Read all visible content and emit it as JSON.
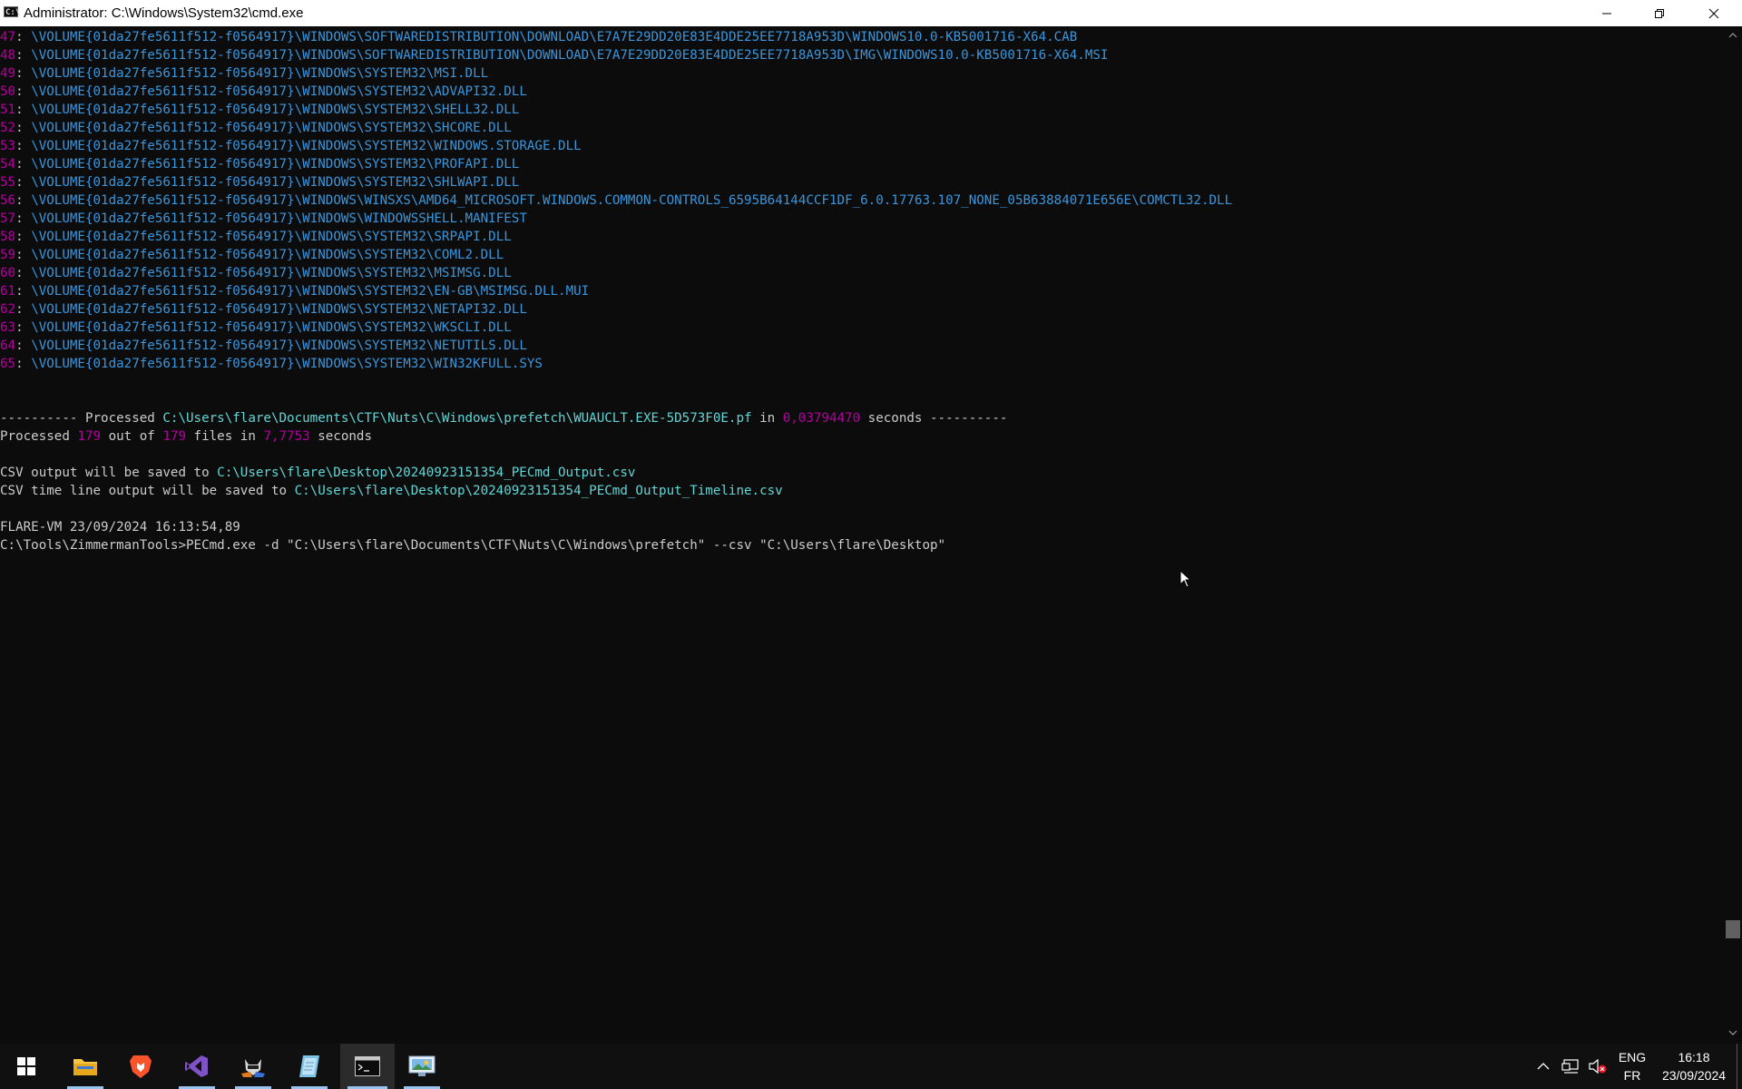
{
  "window": {
    "title": "Administrator: C:\\Windows\\System32\\cmd.exe",
    "app_icon_text": "C:\\"
  },
  "console": {
    "volume": "\\VOLUME{01da27fe5611f512-f0564917}",
    "listing": [
      {
        "num": "47",
        "path": "\\WINDOWS\\SOFTWAREDISTRIBUTION\\DOWNLOAD\\E7A7E29DD20E83E4DDE25EE7718A953D\\WINDOWS10.0-KB5001716-X64.CAB"
      },
      {
        "num": "48",
        "path": "\\WINDOWS\\SOFTWAREDISTRIBUTION\\DOWNLOAD\\E7A7E29DD20E83E4DDE25EE7718A953D\\IMG\\WINDOWS10.0-KB5001716-X64.MSI"
      },
      {
        "num": "49",
        "path": "\\WINDOWS\\SYSTEM32\\MSI.DLL"
      },
      {
        "num": "50",
        "path": "\\WINDOWS\\SYSTEM32\\ADVAPI32.DLL"
      },
      {
        "num": "51",
        "path": "\\WINDOWS\\SYSTEM32\\SHELL32.DLL"
      },
      {
        "num": "52",
        "path": "\\WINDOWS\\SYSTEM32\\SHCORE.DLL"
      },
      {
        "num": "53",
        "path": "\\WINDOWS\\SYSTEM32\\WINDOWS.STORAGE.DLL"
      },
      {
        "num": "54",
        "path": "\\WINDOWS\\SYSTEM32\\PROFAPI.DLL"
      },
      {
        "num": "55",
        "path": "\\WINDOWS\\SYSTEM32\\SHLWAPI.DLL"
      },
      {
        "num": "56",
        "path": "\\WINDOWS\\WINSXS\\AMD64_MICROSOFT.WINDOWS.COMMON-CONTROLS_6595B64144CCF1DF_6.0.17763.107_NONE_05B63884071E656E\\COMCTL32.DLL"
      },
      {
        "num": "57",
        "path": "\\WINDOWS\\WINDOWSSHELL.MANIFEST"
      },
      {
        "num": "58",
        "path": "\\WINDOWS\\SYSTEM32\\SRPAPI.DLL"
      },
      {
        "num": "59",
        "path": "\\WINDOWS\\SYSTEM32\\COML2.DLL"
      },
      {
        "num": "60",
        "path": "\\WINDOWS\\SYSTEM32\\MSIMSG.DLL"
      },
      {
        "num": "61",
        "path": "\\WINDOWS\\SYSTEM32\\EN-GB\\MSIMSG.DLL.MUI"
      },
      {
        "num": "62",
        "path": "\\WINDOWS\\SYSTEM32\\NETAPI32.DLL"
      },
      {
        "num": "63",
        "path": "\\WINDOWS\\SYSTEM32\\WKSCLI.DLL"
      },
      {
        "num": "64",
        "path": "\\WINDOWS\\SYSTEM32\\NETUTILS.DLL"
      },
      {
        "num": "65",
        "path": "\\WINDOWS\\SYSTEM32\\WIN32KFULL.SYS"
      }
    ],
    "processed_line": {
      "prefix": "---------- Processed ",
      "file": "C:\\Users\\flare\\Documents\\CTF\\Nuts\\C\\Windows\\prefetch\\WUAUCLT.EXE-5D573F0E.pf",
      "in_text": " in ",
      "seconds_value": "0,03794470",
      "suffix": " seconds ----------"
    },
    "summary_line": {
      "a": "Processed ",
      "count": "179",
      "b": " out of ",
      "total": "179",
      "c": " files in ",
      "time": "7,7753",
      "d": " seconds"
    },
    "csv_line": {
      "label": "CSV output will be saved to ",
      "path": "C:\\Users\\flare\\Desktop\\20240923151354_PECmd_Output.csv"
    },
    "timeline_line": {
      "label": "CSV time line output will be saved to ",
      "path": "C:\\Users\\flare\\Desktop\\20240923151354_PECmd_Output_Timeline.csv"
    },
    "prompt_header": "FLARE-VM 23/09/2024 16:13:54,89",
    "prompt_line": "C:\\Tools\\ZimmermanTools>PECmd.exe -d \"C:\\Users\\flare\\Documents\\CTF\\Nuts\\C\\Windows\\prefetch\" --csv \"C:\\Users\\flare\\Desktop\""
  },
  "taskbar": {
    "apps": [
      {
        "name": "start-button",
        "icon": "windows-logo-icon"
      },
      {
        "name": "file-explorer",
        "icon": "folder-icon",
        "running": true
      },
      {
        "name": "brave-browser",
        "icon": "brave-lion-icon"
      },
      {
        "name": "visual-studio",
        "icon": "visual-studio-icon",
        "running": true
      },
      {
        "name": "debugger",
        "icon": "hacker-cat-icon",
        "running": true
      },
      {
        "name": "notes-app",
        "icon": "notepad-icon",
        "running": true
      },
      {
        "name": "command-prompt",
        "icon": "terminal-icon",
        "running": true,
        "active": true
      },
      {
        "name": "screen-viewer",
        "icon": "monitor-image-icon",
        "running": true
      }
    ],
    "tray": {
      "language_top": "ENG",
      "language_bottom": "FR",
      "time": "16:18",
      "date": "23/09/2024"
    }
  }
}
